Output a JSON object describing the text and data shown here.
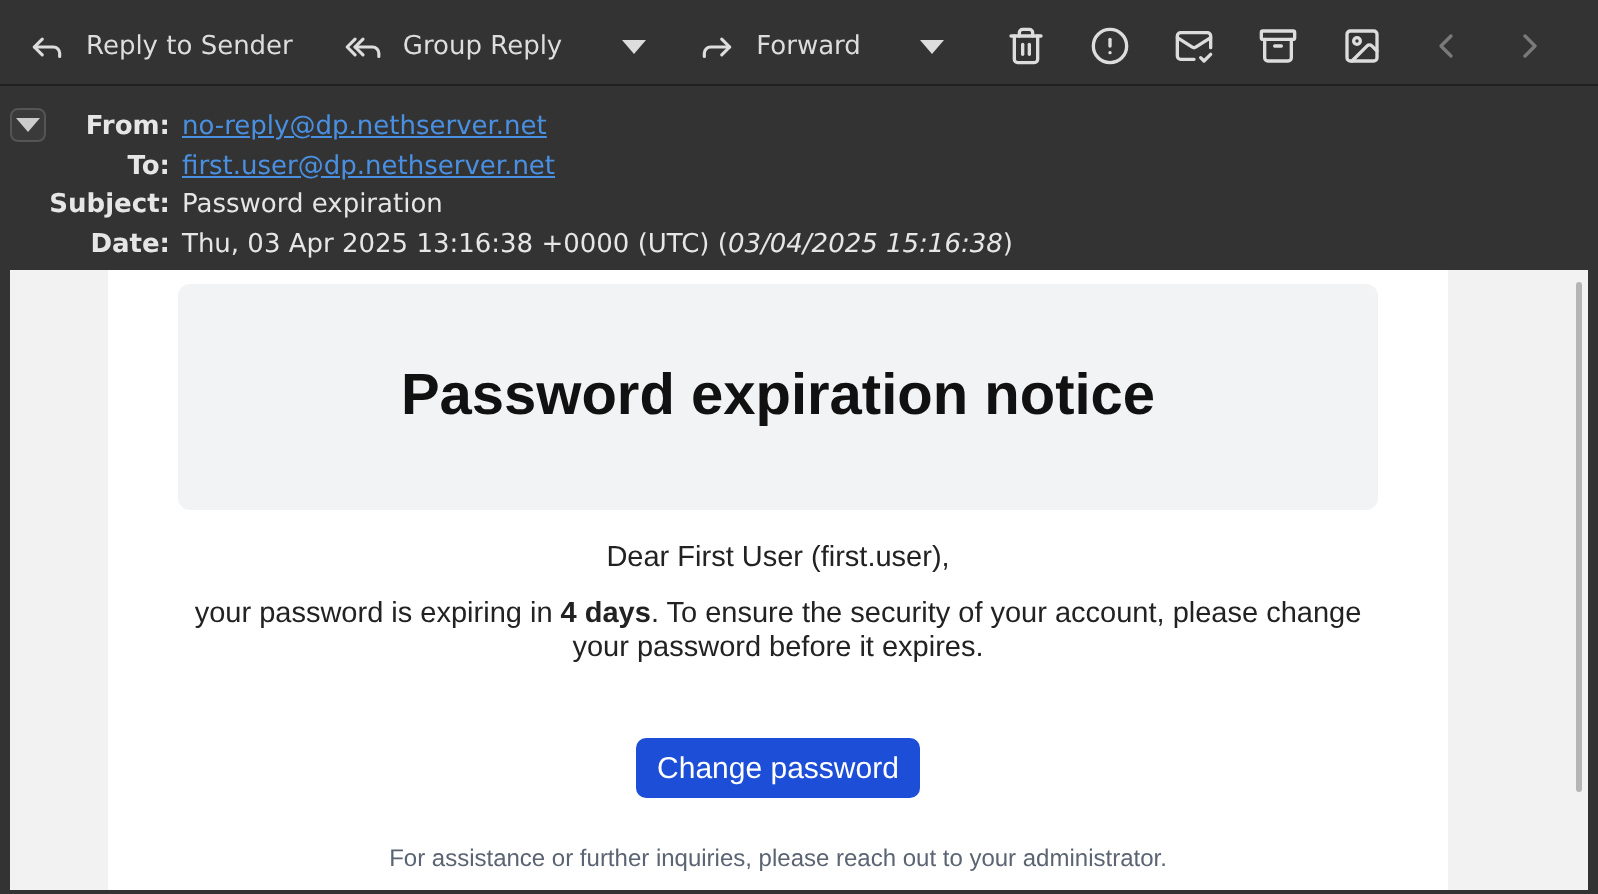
{
  "toolbar": [
    {
      "kind": "labeled",
      "label": "Reply to Sender"
    },
    {
      "kind": "labeled",
      "label": "Group Reply"
    },
    {
      "kind": "menu"
    },
    {
      "kind": "labeled",
      "label": "Forward"
    },
    {
      "kind": "menu"
    },
    {
      "kind": "icon",
      "disabled": false
    },
    {
      "kind": "icon",
      "disabled": false
    },
    {
      "kind": "icon",
      "disabled": false
    },
    {
      "kind": "icon",
      "disabled": false
    },
    {
      "kind": "icon",
      "disabled": false
    },
    {
      "kind": "icon",
      "disabled": true
    },
    {
      "kind": "icon",
      "disabled": true
    }
  ],
  "headers": {
    "expanded": true,
    "fields": [
      {
        "kind": "link",
        "label": "From:",
        "value": "no-reply@dp.nethserver.net"
      },
      {
        "kind": "link",
        "label": "To:",
        "value": "first.user@dp.nethserver.net"
      },
      {
        "kind": "text",
        "label": "Subject:",
        "value": "Password expiration"
      },
      {
        "kind": "text",
        "label": "Date:",
        "value": "Thu, 03 Apr 2025 13:16:38 +0000 (UTC) (*03/04/2025 15:16:38*)"
      }
    ]
  },
  "message": {
    "heading": "Password expiration notice",
    "greeting": "Dear First User (first.user),",
    "body": "your password is expiring in **4 days**. To ensure the security of your account, please change your password before it expires.",
    "button": "Change password",
    "footer": "For assistance or further inquiries, please reach out to your administrator."
  }
}
